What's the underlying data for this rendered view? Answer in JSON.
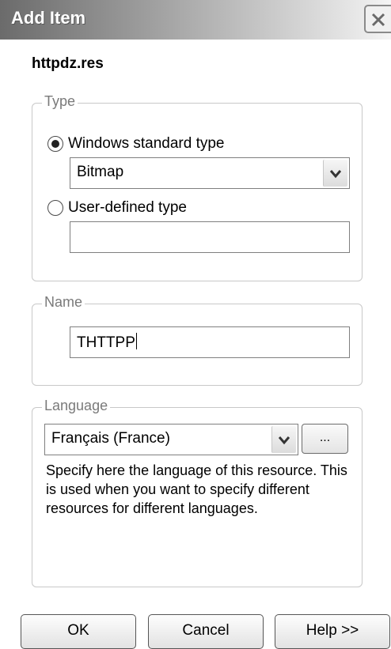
{
  "window": {
    "title": "Add Item"
  },
  "file_name": "httpdz.res",
  "type_group": {
    "label": "Type",
    "standard_option": {
      "label": "Windows standard type",
      "checked": true
    },
    "standard_value": "Bitmap",
    "user_option": {
      "label": "User-defined type",
      "checked": false
    },
    "user_value": ""
  },
  "name_group": {
    "label": "Name",
    "value": "THTTPP"
  },
  "language_group": {
    "label": "Language",
    "value": "Français (France)",
    "browse_label": "...",
    "description": "Specify here the language of this resource. This is used when you want to specify different resources for different languages."
  },
  "buttons": {
    "ok": "OK",
    "cancel": "Cancel",
    "help": "Help >>"
  },
  "icons": {
    "close": "close-icon",
    "dropdown": "chevron-down-icon"
  }
}
